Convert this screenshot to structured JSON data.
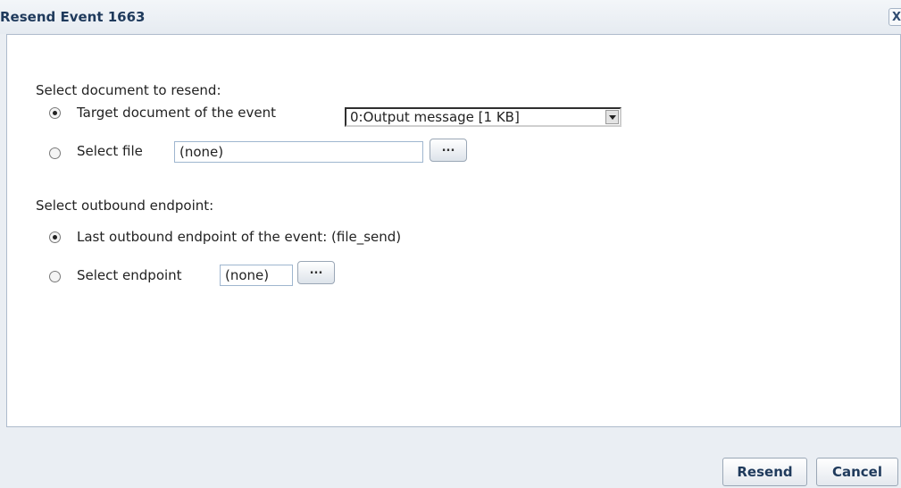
{
  "dialog": {
    "title": "Resend Event 1663",
    "close_label": "X"
  },
  "document_section": {
    "heading": "Select document to resend:",
    "option_target": {
      "label": "Target document of the event",
      "checked": true
    },
    "target_select": {
      "value": "0:Output message [1 KB]"
    },
    "option_file": {
      "label": "Select file",
      "checked": false
    },
    "file_input": {
      "value": "(none)"
    },
    "file_browse_label": "..."
  },
  "endpoint_section": {
    "heading": "Select outbound endpoint:",
    "option_last": {
      "label": "Last outbound endpoint of the event: (file_send)",
      "checked": true
    },
    "option_select": {
      "label": "Select endpoint",
      "checked": false
    },
    "endpoint_input": {
      "value": "(none)"
    },
    "endpoint_browse_label": "..."
  },
  "footer": {
    "resend_label": "Resend",
    "cancel_label": "Cancel"
  }
}
